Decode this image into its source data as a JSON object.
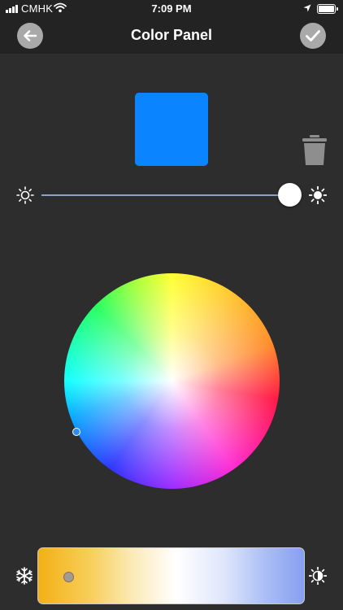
{
  "status_bar": {
    "carrier": "CMHK",
    "time": "7:09 PM",
    "icons": [
      "signal-icon",
      "wifi-icon",
      "location-arrow-icon",
      "battery-icon"
    ]
  },
  "nav": {
    "title": "Color Panel",
    "back_icon": "arrow-left-icon",
    "done_icon": "checkmark-icon"
  },
  "preview": {
    "color": "#0a84ff",
    "delete_icon": "trash-icon"
  },
  "brightness": {
    "min_icon": "sun-dim-icon",
    "max_icon": "sun-bright-icon",
    "level": 0.94
  },
  "color_wheel": {
    "selected_color": "#2d8cf0"
  },
  "temperature": {
    "cool_icon": "snowflake-icon",
    "warm_icon": "sun-warm-icon",
    "level": 0.11
  },
  "colors": {
    "background": "#2d2d2d",
    "bars": "#232323",
    "nav_button": "#a9a9a9",
    "slider_track": "#8ea2c9"
  }
}
